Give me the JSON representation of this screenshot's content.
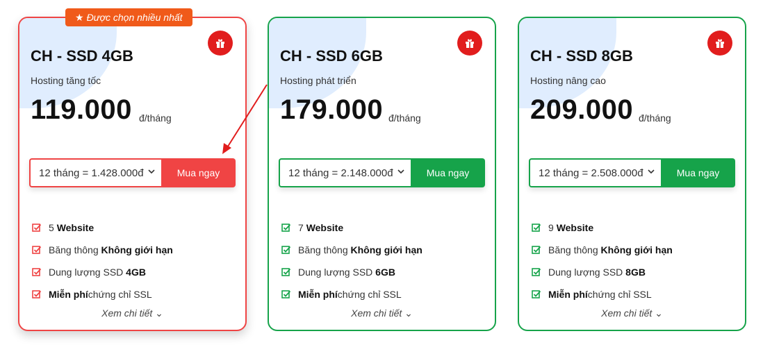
{
  "badge": {
    "label": "Được chọn nhiều nhất"
  },
  "plans": [
    {
      "name": "CH - SSD 4GB",
      "tagline": "Hosting tăng tốc",
      "price": "119.000",
      "unit": "đ/tháng",
      "term": "12 tháng = 1.428.000đ",
      "buy_label": "Mua ngay",
      "features": [
        {
          "pre": "5 ",
          "bold": "Website",
          "post": ""
        },
        {
          "pre": "Băng thông ",
          "bold": "Không giới hạn",
          "post": ""
        },
        {
          "pre": "Dung lượng SSD ",
          "bold": "4GB",
          "post": ""
        },
        {
          "pre": "",
          "bold": "Miễn phí",
          "post": " chứng chỉ SSL"
        }
      ],
      "more_label": "Xem chi tiết"
    },
    {
      "name": "CH - SSD 6GB",
      "tagline": "Hosting phát triển",
      "price": "179.000",
      "unit": "đ/tháng",
      "term": "12 tháng = 2.148.000đ",
      "buy_label": "Mua ngay",
      "features": [
        {
          "pre": "7 ",
          "bold": "Website",
          "post": ""
        },
        {
          "pre": "Băng thông ",
          "bold": "Không giới hạn",
          "post": ""
        },
        {
          "pre": "Dung lượng SSD ",
          "bold": "6GB",
          "post": ""
        },
        {
          "pre": "",
          "bold": "Miễn phí",
          "post": " chứng chỉ SSL"
        }
      ],
      "more_label": "Xem chi tiết"
    },
    {
      "name": "CH - SSD 8GB",
      "tagline": "Hosting nâng cao",
      "price": "209.000",
      "unit": "đ/tháng",
      "term": "12 tháng = 2.508.000đ",
      "buy_label": "Mua ngay",
      "features": [
        {
          "pre": "9 ",
          "bold": "Website",
          "post": ""
        },
        {
          "pre": "Băng thông ",
          "bold": "Không giới hạn",
          "post": ""
        },
        {
          "pre": "Dung lượng SSD ",
          "bold": "8GB",
          "post": ""
        },
        {
          "pre": "",
          "bold": "Miễn phí",
          "post": " chứng chỉ SSL"
        }
      ],
      "more_label": "Xem chi tiết"
    }
  ],
  "icons": {
    "badge": "star-icon",
    "gift": "gift-icon",
    "feature": "checkbox-check-icon",
    "dropdown": "chevron-down-icon",
    "more": "chevron-down-icon"
  },
  "colors": {
    "featured": "#ef4444",
    "standard": "#16a34a",
    "badge_bg": "#f05a1a",
    "gift_bg": "#e11d1d",
    "annotation_arrow": "#e11d1d"
  }
}
